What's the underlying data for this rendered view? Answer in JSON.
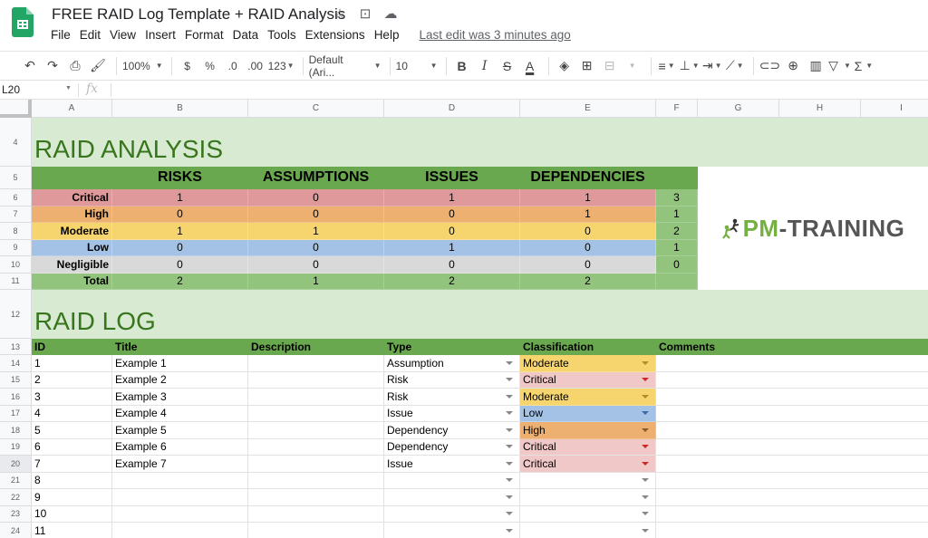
{
  "app": {
    "doc_title": "FREE RAID Log Template + RAID Analysis",
    "title_icons": [
      "star-icon",
      "move-to-folder-icon",
      "cloud-status-icon"
    ],
    "menu": [
      "File",
      "Edit",
      "View",
      "Insert",
      "Format",
      "Data",
      "Tools",
      "Extensions",
      "Help"
    ],
    "last_edit": "Last edit was 3 minutes ago"
  },
  "toolbar": {
    "zoom": "100%",
    "currency": "$",
    "percent": "%",
    "decrease_decimal": ".0",
    "increase_decimal": ".00",
    "more_formats": "123",
    "font": "Default (Ari...",
    "font_size": "10",
    "bold": "B",
    "italic": "I",
    "strike": "S",
    "text_color": "A"
  },
  "formula_bar": {
    "name_box": "L20",
    "fx": "fx",
    "value": ""
  },
  "columns": [
    "A",
    "B",
    "C",
    "D",
    "E",
    "F",
    "G",
    "H",
    "I"
  ],
  "rows": [
    "4",
    "5",
    "6",
    "7",
    "8",
    "9",
    "10",
    "11",
    "12",
    "13",
    "14",
    "15",
    "16",
    "17",
    "18",
    "19",
    "20",
    "21",
    "22",
    "23",
    "24"
  ],
  "analysis": {
    "title": "RAID  ANALYSIS",
    "headers": [
      "RISKS",
      "ASSUMPTIONS",
      "ISSUES",
      "DEPENDENCIES"
    ],
    "rows": [
      {
        "label": "Critical",
        "values": [
          "1",
          "0",
          "1",
          "1"
        ],
        "total": "3"
      },
      {
        "label": "High",
        "values": [
          "0",
          "0",
          "0",
          "1"
        ],
        "total": "1"
      },
      {
        "label": "Moderate",
        "values": [
          "1",
          "1",
          "0",
          "0"
        ],
        "total": "2"
      },
      {
        "label": "Low",
        "values": [
          "0",
          "0",
          "1",
          "0"
        ],
        "total": "1"
      },
      {
        "label": "Negligible",
        "values": [
          "0",
          "0",
          "0",
          "0"
        ],
        "total": "0"
      },
      {
        "label": "Total",
        "values": [
          "2",
          "1",
          "2",
          "2"
        ],
        "total": ""
      }
    ],
    "colors": {
      "Critical": "#e0999a",
      "High": "#eeb070",
      "Moderate": "#f7d56e",
      "Low": "#a4c2e6",
      "Negligible": "#d9d9d9",
      "Total": "#93c47d"
    }
  },
  "logo": {
    "pm": "PM",
    "rest": "-TRAINING"
  },
  "log": {
    "title": "RAID  LOG",
    "headers": [
      "ID",
      "Title",
      "Description",
      "Type",
      "Classification",
      "Comments"
    ],
    "rows": [
      {
        "id": "1",
        "title": "Example 1",
        "description": "",
        "type": "Assumption",
        "classification": "Moderate",
        "comments": ""
      },
      {
        "id": "2",
        "title": "Example 2",
        "description": "",
        "type": "Risk",
        "classification": "Critical",
        "comments": ""
      },
      {
        "id": "3",
        "title": "Example 3",
        "description": "",
        "type": "Risk",
        "classification": "Moderate",
        "comments": ""
      },
      {
        "id": "4",
        "title": "Example 4",
        "description": "",
        "type": "Issue",
        "classification": "Low",
        "comments": ""
      },
      {
        "id": "5",
        "title": "Example 5",
        "description": "",
        "type": "Dependency",
        "classification": "High",
        "comments": ""
      },
      {
        "id": "6",
        "title": "Example 6",
        "description": "",
        "type": "Dependency",
        "classification": "Critical",
        "comments": ""
      },
      {
        "id": "7",
        "title": "Example 7",
        "description": "",
        "type": "Issue",
        "classification": "Critical",
        "comments": ""
      },
      {
        "id": "8",
        "title": "",
        "description": "",
        "type": "",
        "classification": "",
        "comments": ""
      },
      {
        "id": "9",
        "title": "",
        "description": "",
        "type": "",
        "classification": "",
        "comments": ""
      },
      {
        "id": "10",
        "title": "",
        "description": "",
        "type": "",
        "classification": "",
        "comments": ""
      },
      {
        "id": "11",
        "title": "",
        "description": "",
        "type": "",
        "classification": "",
        "comments": ""
      }
    ],
    "classification_colors": {
      "Critical": "#f0c8c7",
      "High": "#eeb070",
      "Moderate": "#f7d56e",
      "Low": "#a4c2e6"
    }
  }
}
